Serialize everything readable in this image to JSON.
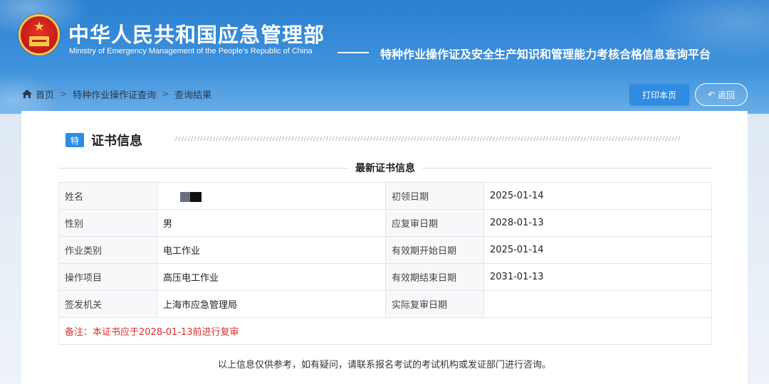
{
  "header": {
    "ministry_cn": "中华人民共和国应急管理部",
    "ministry_en": "Ministry of Emergency Management of the People’s Republic of China",
    "platform_title": "特种作业操作证及安全生产知识和管理能力考核合格信息查询平台",
    "emblem_star": "★"
  },
  "breadcrumb": {
    "items": [
      "首页",
      "特种作业操作证查询",
      "查询结果"
    ],
    "separator": ">"
  },
  "actions": {
    "print_label": "打印本页",
    "back_label": "返回",
    "back_icon": "↶"
  },
  "card": {
    "badge": "特",
    "title": "证书信息",
    "subtitle": "最新证书信息",
    "rows": [
      {
        "label_left": "姓名",
        "value_left": "",
        "label_right": "初领日期",
        "value_right": "2025-01-14"
      },
      {
        "label_left": "性别",
        "value_left": "男",
        "label_right": "应复审日期",
        "value_right": "2028-01-13"
      },
      {
        "label_left": "作业类别",
        "value_left": "电工作业",
        "label_right": "有效期开始日期",
        "value_right": "2025-01-14"
      },
      {
        "label_left": "操作项目",
        "value_left": "高压电工作业",
        "label_right": "有效期结束日期",
        "value_right": "2031-01-13"
      },
      {
        "label_left": "签发机关",
        "value_left": "上海市应急管理局",
        "label_right": "实际复审日期",
        "value_right": ""
      }
    ],
    "note": "备注：本证书应于2028-01-13前进行复审",
    "footer": "以上信息仅供参考，如有疑问，请联系报名考试的考试机构或发证部门进行咨询。"
  },
  "colors": {
    "primary": "#2f8ce0",
    "note_red": "#d9302c",
    "header_blue": "#3f92dc"
  }
}
